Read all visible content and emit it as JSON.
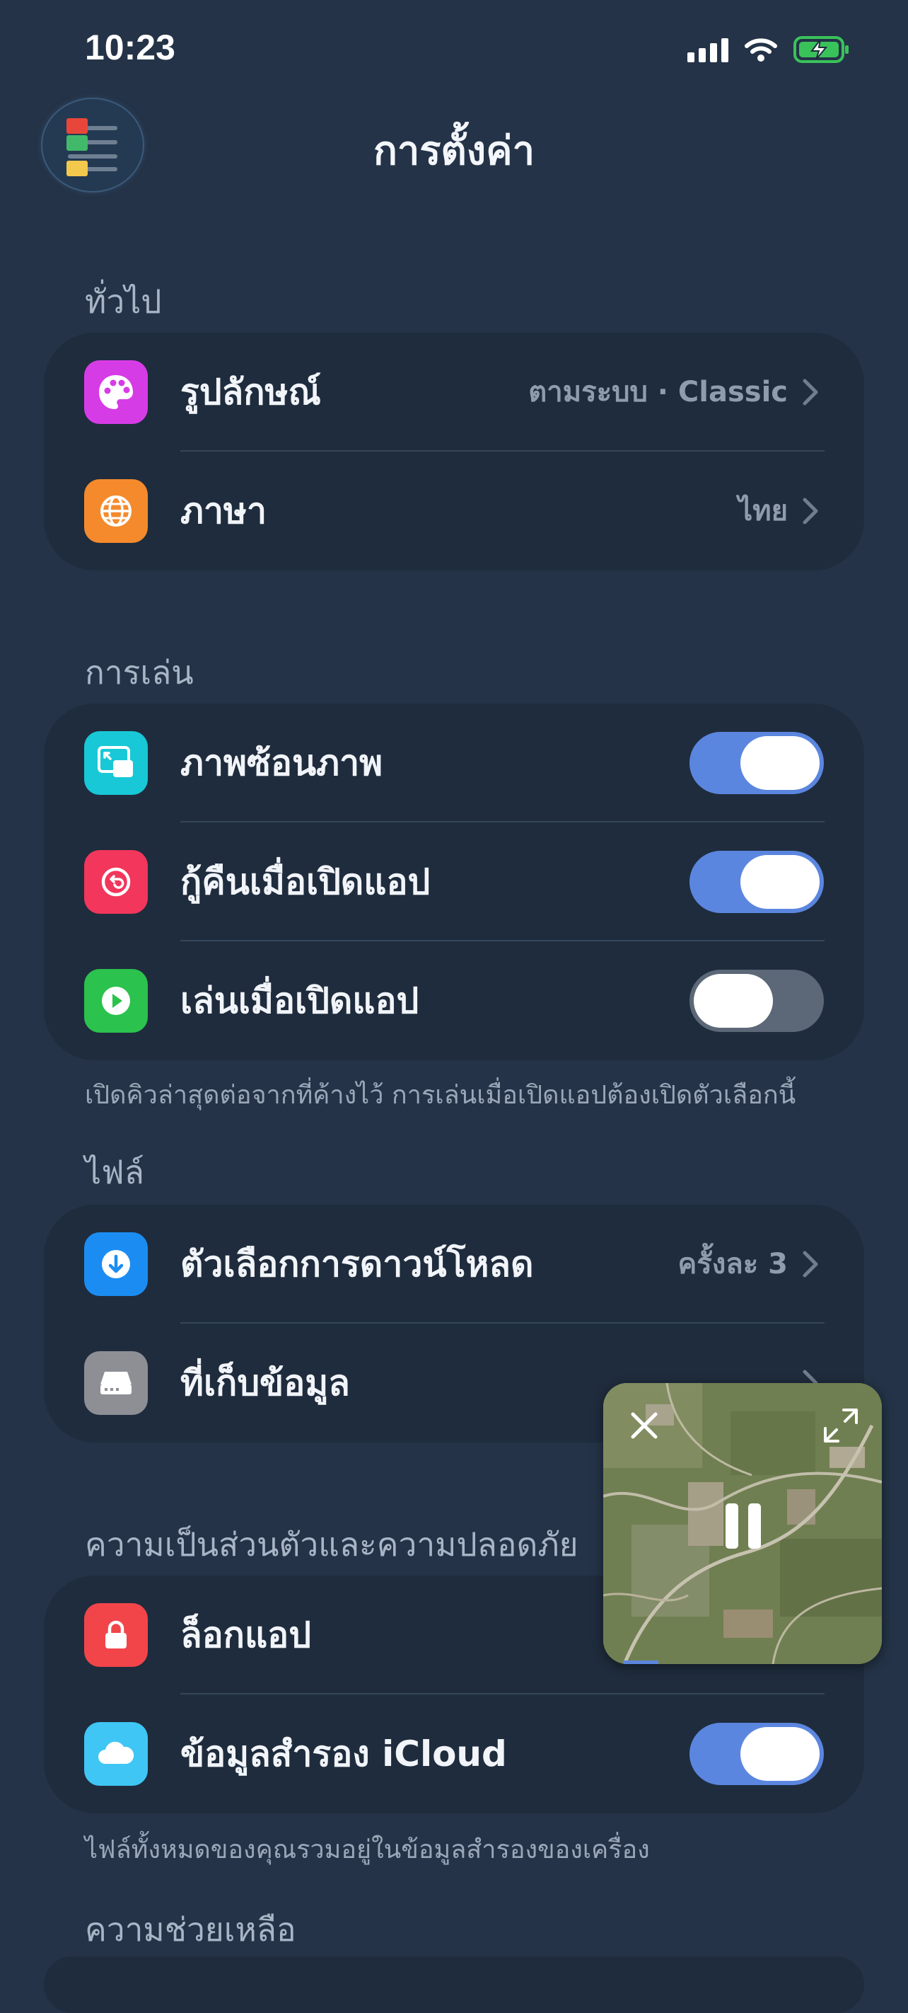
{
  "status_bar": {
    "time": "10:23",
    "icons": [
      "cellular-signal-icon",
      "wifi-icon",
      "battery-charging-icon"
    ]
  },
  "header": {
    "title": "การตั้งค่า",
    "menu_icon": "app-logo-menu-icon"
  },
  "sections": {
    "general": {
      "title": "ทั่วไป",
      "rows": [
        {
          "label": "รูปลักษณ์",
          "value": "ตามระบบ · Classic",
          "icon": "palette-icon",
          "color": "#d63ce6"
        },
        {
          "label": "ภาษา",
          "value": "ไทย",
          "icon": "globe-icon",
          "color": "#f48a2c"
        }
      ]
    },
    "playback": {
      "title": "การเล่น",
      "rows": [
        {
          "label": "ภาพซ้อนภาพ",
          "icon": "picture-in-picture-icon",
          "color": "#18c8d6",
          "toggle": true
        },
        {
          "label": "กู้คืนเมื่อเปิดแอป",
          "icon": "restore-icon",
          "color": "#f2365c",
          "toggle": true
        },
        {
          "label": "เล่นเมื่อเปิดแอป",
          "icon": "play-icon",
          "color": "#2bc24d",
          "toggle": false
        }
      ],
      "footer": "เปิดคิวล่าสุดต่อจากที่ค้างไว้ การเล่นเมื่อเปิดแอปต้องเปิดตัวเลือกนี้"
    },
    "files": {
      "title": "ไฟล์",
      "rows": [
        {
          "label": "ตัวเลือกการดาวน์โหลด",
          "value": "ครั้งละ 3",
          "icon": "download-icon",
          "color": "#1b8df2"
        },
        {
          "label": "ที่เก็บข้อมูล",
          "icon": "storage-drive-icon",
          "color": "#8e8f95"
        }
      ]
    },
    "privacy": {
      "title": "ความเป็นส่วนตัวและความปลอดภัย",
      "rows": [
        {
          "label": "ล็อกแอป",
          "icon": "lock-icon",
          "color": "#f2454a"
        },
        {
          "label": "ข้อมูลสำรอง iCloud",
          "icon": "cloud-icon",
          "color": "#3fc6f4",
          "toggle": true
        }
      ],
      "footer": "ไฟล์ทั้งหมดของคุณรวมอยู่ในข้อมูลสำรองของเครื่อง"
    },
    "help": {
      "title": "ความช่วยเหลือ"
    }
  },
  "pip": {
    "controls": [
      "close-icon",
      "expand-icon",
      "pause-icon"
    ],
    "progress": 0.05
  },
  "colors": {
    "background": "#243347",
    "card": "#1f2c3d",
    "toggle_on": "#5b86df",
    "toggle_off": "#5c6877"
  }
}
